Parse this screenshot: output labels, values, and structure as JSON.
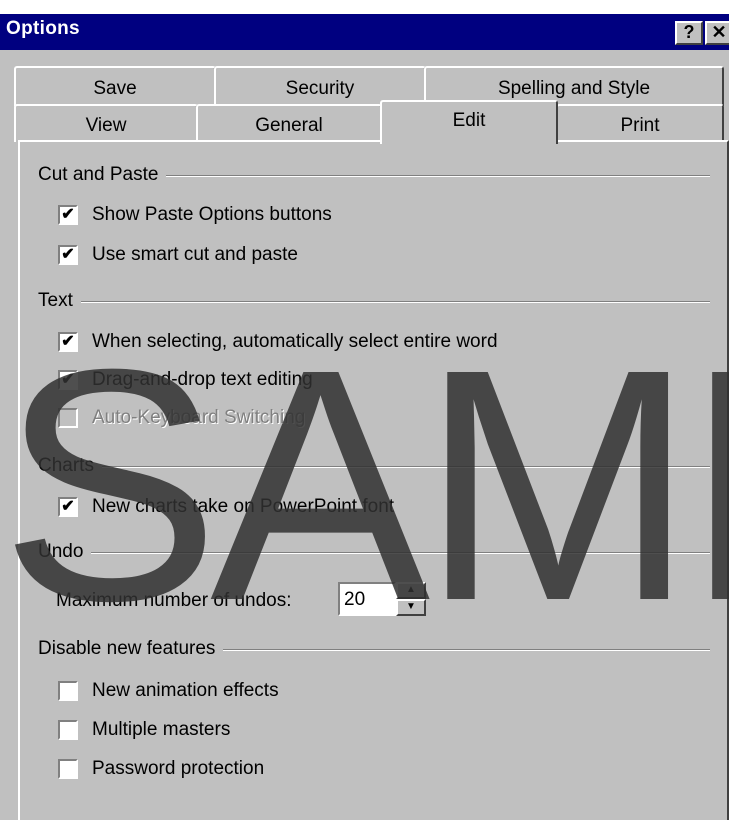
{
  "window": {
    "title": "Options",
    "help_label": "?",
    "close_label": "✕"
  },
  "tabs": {
    "row_back": [
      "Save",
      "Security",
      "Spelling and Style"
    ],
    "row_front": [
      "View",
      "General",
      "Edit",
      "Print"
    ],
    "active": "Edit"
  },
  "sections": {
    "cut_paste": {
      "title": "Cut and Paste",
      "show_paste_options": {
        "label": "Show Paste Options buttons",
        "checked": true
      },
      "smart_cut_paste": {
        "label": "Use smart cut and paste",
        "checked": true
      }
    },
    "text": {
      "title": "Text",
      "select_entire_word": {
        "label": "When selecting, automatically select entire word",
        "checked": true
      },
      "drag_drop": {
        "label": "Drag-and-drop text editing",
        "checked": true
      },
      "auto_keyboard": {
        "label": "Auto-Keyboard Switching",
        "checked": false
      }
    },
    "charts": {
      "title": "Charts",
      "powerpoint_font": {
        "label": "New charts take on PowerPoint font",
        "checked": true
      }
    },
    "undo": {
      "title": "Undo",
      "max_label": "Maximum number of undos:",
      "max_value": "20"
    },
    "disable_features": {
      "title": "Disable new features",
      "animation_effects": {
        "label": "New animation effects",
        "checked": false
      },
      "multiple_masters": {
        "label": "Multiple masters",
        "checked": false
      },
      "password_protection": {
        "label": "Password protection",
        "checked": false
      }
    }
  },
  "watermark": "SAMPLE",
  "colors": {
    "titlebar": "#000080",
    "face": "#c0c0c0"
  },
  "icons": {
    "check": "✔",
    "spin_up": "▲",
    "spin_down": "▼"
  }
}
